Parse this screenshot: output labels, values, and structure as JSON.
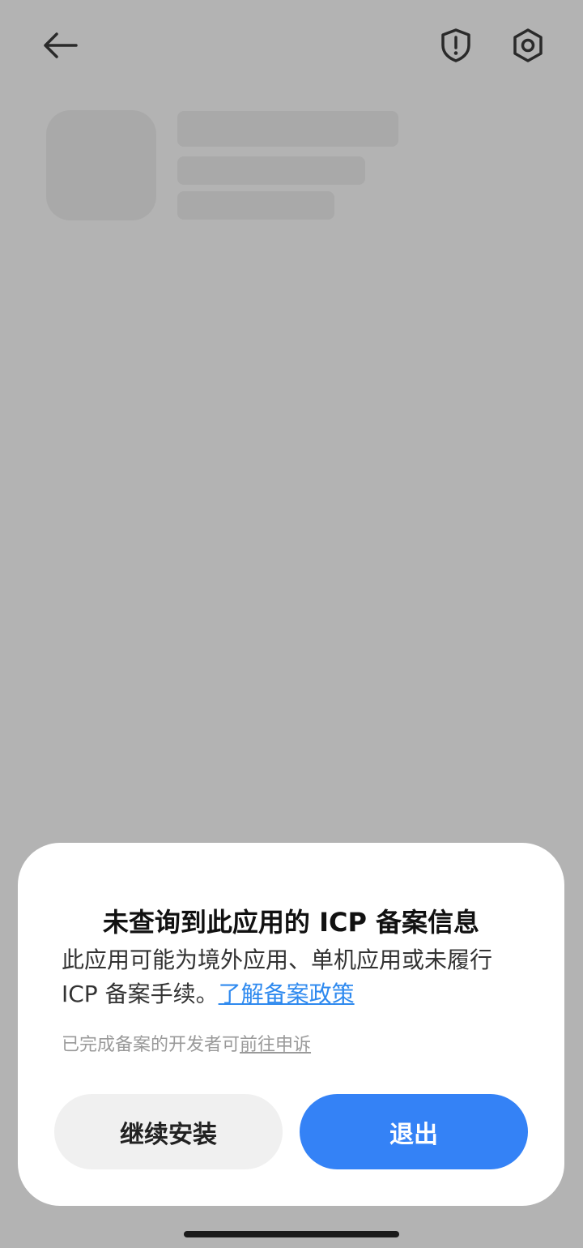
{
  "topbar": {
    "back_icon": "arrow-left-icon",
    "security_icon": "shield-exclamation-icon",
    "settings_icon": "gear-icon"
  },
  "dialog": {
    "title": "未查询到此应用的 ICP 备案信息",
    "description": "此应用可能为境外应用、单机应用或未履行 ICP 备案手续。",
    "policy_link": "了解备案政策",
    "appeal_prefix": "已完成备案的开发者可",
    "appeal_link": "前往申诉",
    "continue_label": "继续安装",
    "exit_label": "退出"
  },
  "colors": {
    "overlay_background": "#b3b3b3",
    "accent": "#3482f6",
    "link": "#2f8aef"
  }
}
